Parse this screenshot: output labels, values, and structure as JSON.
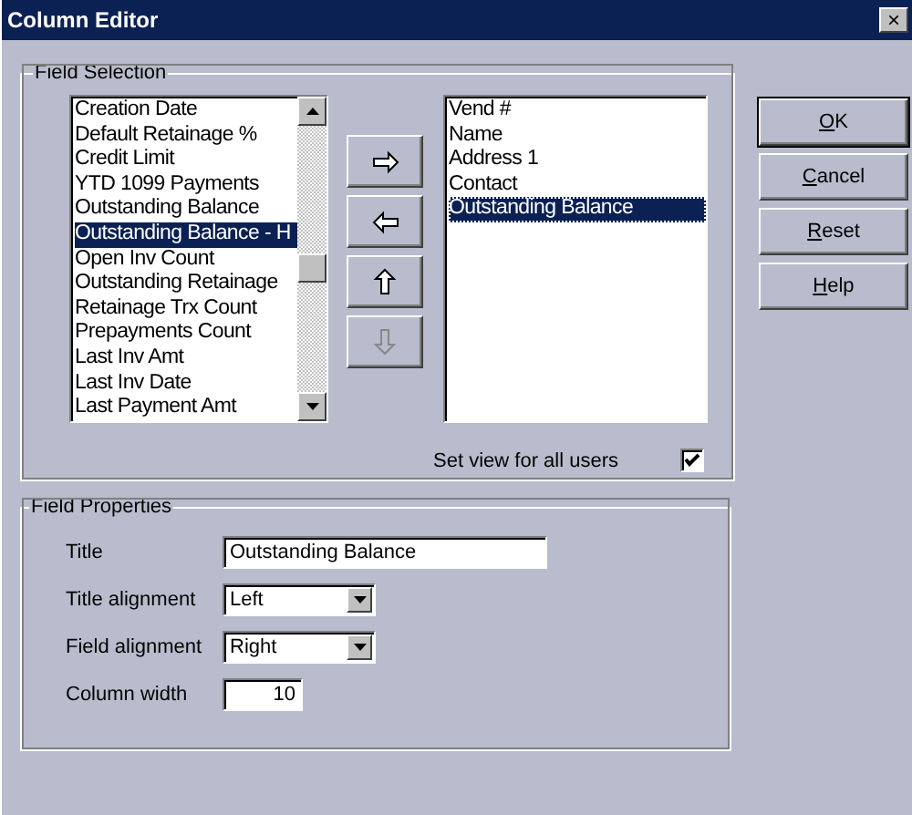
{
  "window": {
    "title": "Column Editor",
    "close": "×"
  },
  "field_selection": {
    "title": "Field Selection",
    "available_fields": [
      {
        "label": "Creation Date",
        "selected": false
      },
      {
        "label": "Default Retainage %",
        "selected": false
      },
      {
        "label": "Credit Limit",
        "selected": false
      },
      {
        "label": "YTD 1099 Payments",
        "selected": false
      },
      {
        "label": "Outstanding Balance",
        "selected": false
      },
      {
        "label": "Outstanding Balance - H",
        "selected": true
      },
      {
        "label": "Open Inv Count",
        "selected": false
      },
      {
        "label": "Outstanding Retainage",
        "selected": false
      },
      {
        "label": "Retainage Trx Count",
        "selected": false
      },
      {
        "label": "Prepayments Count",
        "selected": false
      },
      {
        "label": "Last Inv Amt",
        "selected": false
      },
      {
        "label": "Last Inv Date",
        "selected": false
      },
      {
        "label": "Last Payment Amt",
        "selected": false
      }
    ],
    "move_buttons": [
      {
        "kind": "right",
        "disabled": false
      },
      {
        "kind": "left",
        "disabled": false
      },
      {
        "kind": "up",
        "disabled": false
      },
      {
        "kind": "down",
        "disabled": true
      }
    ],
    "selected_fields": [
      {
        "label": "Vend #",
        "selected": false
      },
      {
        "label": "Name",
        "selected": false
      },
      {
        "label": "Address 1",
        "selected": false
      },
      {
        "label": "Contact",
        "selected": false
      },
      {
        "label": "Outstanding Balance",
        "selected": true
      }
    ],
    "set_view_for_all_users": {
      "label": "Set view for all users",
      "checked": true
    }
  },
  "field_properties": {
    "title": "Field Properties",
    "title_field": {
      "label": "Title",
      "value": "Outstanding Balance"
    },
    "title_alignment": {
      "label": "Title alignment",
      "value": "Left"
    },
    "field_alignment": {
      "label": "Field alignment",
      "value": "Right"
    },
    "column_width": {
      "label": "Column width",
      "value": "10"
    }
  },
  "buttons": [
    "OK",
    "Cancel",
    "Reset",
    "Help"
  ]
}
